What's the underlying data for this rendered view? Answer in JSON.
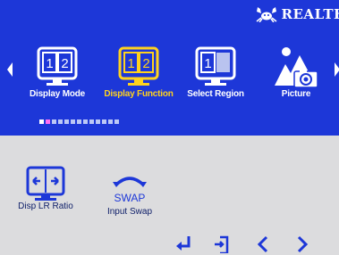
{
  "brand": {
    "text": "REALTE",
    "logo_icon": "realtek-crab-logo-icon"
  },
  "colors": {
    "menu_bg": "#1d37d8",
    "active": "#ffd21e",
    "sub_bg": "#dcdcde",
    "icon_blue": "#1d37d8"
  },
  "menu": {
    "items": [
      {
        "label": "Display Mode",
        "icon": "dual-monitor-icon",
        "numbers": [
          "1",
          "2"
        ]
      },
      {
        "label": "Display Function",
        "icon": "dual-monitor-icon",
        "numbers": [
          "1",
          "2"
        ],
        "active": true
      },
      {
        "label": "Select Region",
        "icon": "select-region-monitor-icon",
        "numbers": [
          "1"
        ]
      },
      {
        "label": "Picture",
        "icon": "picture-camera-icon"
      }
    ],
    "page_indicator": {
      "count": 13,
      "current": 1
    }
  },
  "submenu": {
    "items": [
      {
        "label": "Disp LR Ratio",
        "icon": "lr-ratio-icon"
      },
      {
        "label": "Input Swap",
        "icon": "swap-icon",
        "icon_text": "SWAP"
      }
    ]
  },
  "nav": {
    "icons": [
      "enter-icon",
      "exit-icon",
      "left-arrow-icon",
      "right-arrow-icon"
    ]
  }
}
